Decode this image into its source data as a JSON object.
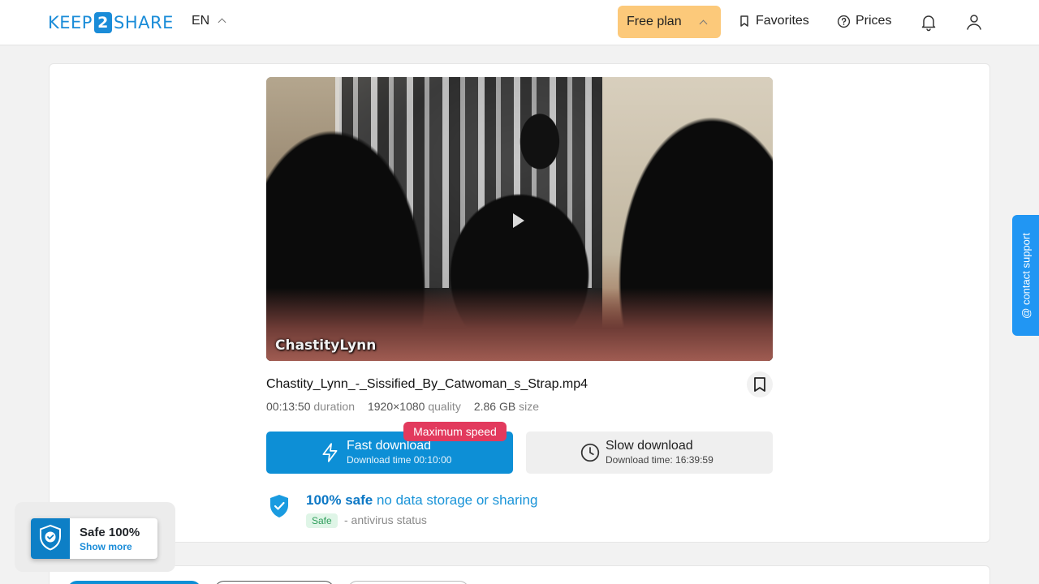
{
  "header": {
    "logo": {
      "left": "KEEP",
      "middle": "2",
      "right": "SHARE"
    },
    "language": "EN",
    "plan_label": "Free plan",
    "favorites_label": "Favorites",
    "prices_label": "Prices"
  },
  "file": {
    "preview_watermark": "ChastityLynn",
    "name": "Chastity_Lynn_-_Sissified_By_Catwoman_s_Strap.mp4",
    "duration_value": "00:13:50",
    "duration_label": "duration",
    "quality_value": "1920×1080",
    "quality_label": "quality",
    "size_value": "2.86 GB",
    "size_label": "size"
  },
  "downloads": {
    "badge": "Maximum speed",
    "fast": {
      "title": "Fast download",
      "subtitle": "Download time 00:10:00"
    },
    "slow": {
      "title": "Slow download",
      "subtitle": "Download time: 16:39:59"
    }
  },
  "safety": {
    "strong": "100% safe",
    "rest": "no data storage or sharing",
    "pill": "Safe",
    "status": "- antivirus status"
  },
  "contact_support": "@ contact support",
  "widget": {
    "title": "Safe 100%",
    "link": "Show more"
  },
  "colors": {
    "brand": "#1a8cd8",
    "plan": "#fcc97a",
    "fast_button": "#0d8fd6",
    "badge": "#e23a5d",
    "contact": "#2196f3"
  }
}
